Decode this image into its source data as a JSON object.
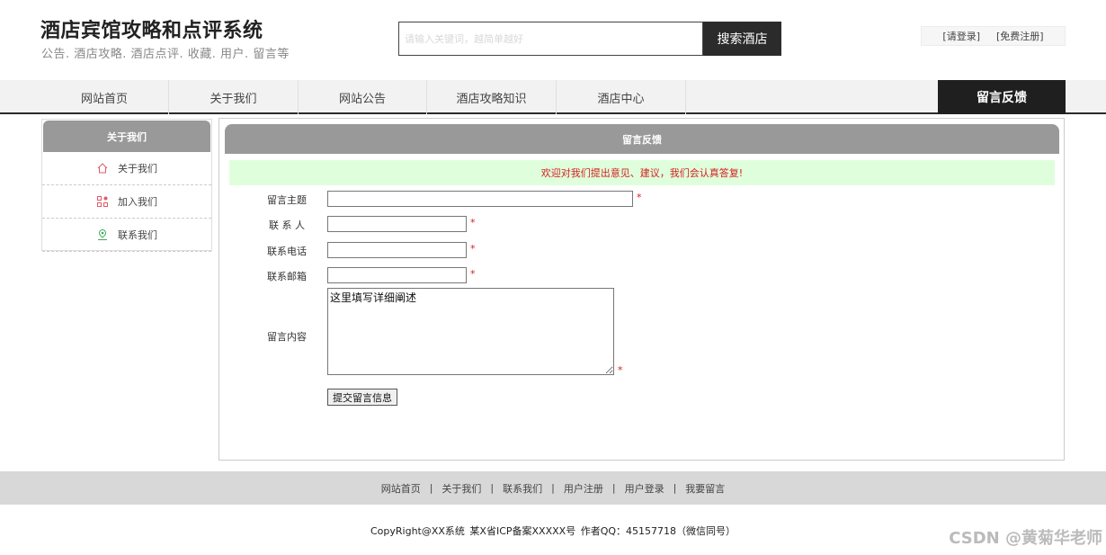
{
  "header": {
    "title": "酒店宾馆攻略和点评系统",
    "subtitle": "公告. 酒店攻略. 酒店点评. 收藏. 用户. 留言等",
    "search_placeholder": "请输入关键词，越简单越好",
    "search_button": "搜索酒店",
    "login": "[请登录]",
    "register": "[免费注册]"
  },
  "nav": {
    "items": [
      "网站首页",
      "关于我们",
      "网站公告",
      "酒店攻略知识",
      "酒店中心"
    ],
    "active": "留言反馈"
  },
  "sidebar": {
    "title": "关于我们",
    "items": [
      {
        "label": "关于我们",
        "icon": "home-icon"
      },
      {
        "label": "加入我们",
        "icon": "grid-icon"
      },
      {
        "label": "联系我们",
        "icon": "location-icon"
      }
    ]
  },
  "panel": {
    "title": "留言反馈",
    "notice": "欢迎对我们提出意见、建议，我们会认真答复!",
    "fields": {
      "subject": "留言主题",
      "contact": "联 系 人",
      "phone": "联系电话",
      "email": "联系邮箱",
      "content": "留言内容"
    },
    "content_value": "这里填写详细阐述",
    "required_mark": "*",
    "submit": "提交留言信息"
  },
  "footer": {
    "links": [
      "网站首页",
      "关于我们",
      "联系我们",
      "用户注册",
      "用户登录",
      "我要留言"
    ],
    "separator": "|",
    "copyright": "CopyRight@XX系统    某X省ICP备案XXXXX号    作者QQ：45157718（微信同号）"
  },
  "watermark": "CSDN @黄菊华老师",
  "colors": {
    "dark": "#2b2b2b",
    "panel_head": "#999999",
    "notice_bg": "#dfffdc",
    "required": "#d42020"
  }
}
